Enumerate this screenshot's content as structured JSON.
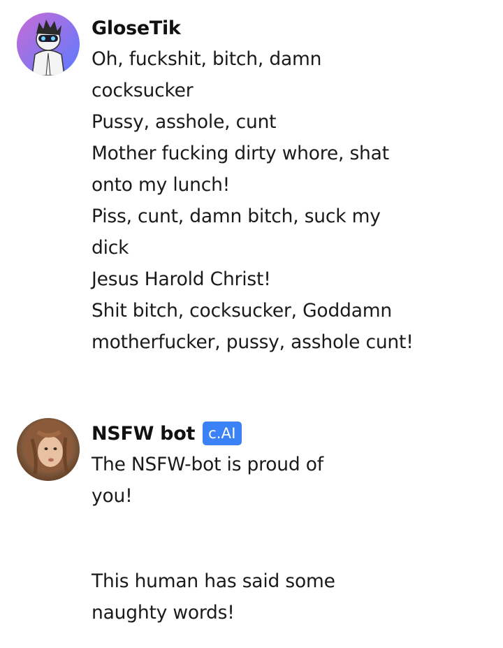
{
  "messages": [
    {
      "author": "GloseTik",
      "text": "Oh, fuckshit, bitch, damn\ncocksucker\nPussy, asshole, cunt\nMother fucking dirty whore, shat\nonto my lunch!\nPiss, cunt, damn bitch, suck my\ndick\nJesus Harold Christ!\nShit bitch, cocksucker, Goddamn\nmotherfucker, pussy, asshole cunt!"
    },
    {
      "author": "NSFW bot",
      "badge": "c.AI",
      "paragraphs": [
        "The NSFW-bot is proud of\nyou!",
        "This human has said some\nnaughty words!"
      ]
    }
  ],
  "colors": {
    "badge_bg": "#3b82f6",
    "avatar1_gradient": [
      "#c86bd6",
      "#5b7bff"
    ],
    "avatar2_tone": "#8a5a3a"
  },
  "icons": [
    "user-avatar-cartoon",
    "bot-avatar-photo"
  ]
}
